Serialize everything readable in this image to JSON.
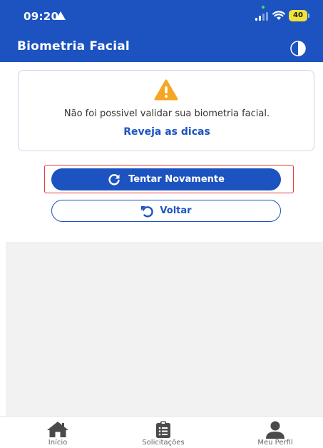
{
  "status_bar": {
    "time": "09:20",
    "battery": "40",
    "icons": [
      "location-arrow-icon",
      "signal-icon",
      "wifi-icon",
      "battery-icon"
    ]
  },
  "app_bar": {
    "title": "Biometria Facial",
    "contrast_icon": "contrast-icon"
  },
  "alert": {
    "icon": "warning-icon",
    "message": "Não foi possivel validar sua biometria facial.",
    "link": "Reveja as dicas"
  },
  "actions": {
    "retry_label": "Tentar Novamente",
    "retry_icon": "refresh-icon",
    "back_label": "Voltar",
    "back_icon": "undo-icon"
  },
  "bottom_nav": {
    "items": [
      {
        "label": "Início",
        "icon": "home-icon"
      },
      {
        "label": "Solicitações",
        "icon": "clipboard-list-icon"
      },
      {
        "label": "Meu Perfil",
        "icon": "user-icon"
      }
    ]
  },
  "colors": {
    "primary": "#1c53c0",
    "warning": "#f5a623",
    "highlight": "#e53a3a",
    "battery": "#f0e23a"
  }
}
